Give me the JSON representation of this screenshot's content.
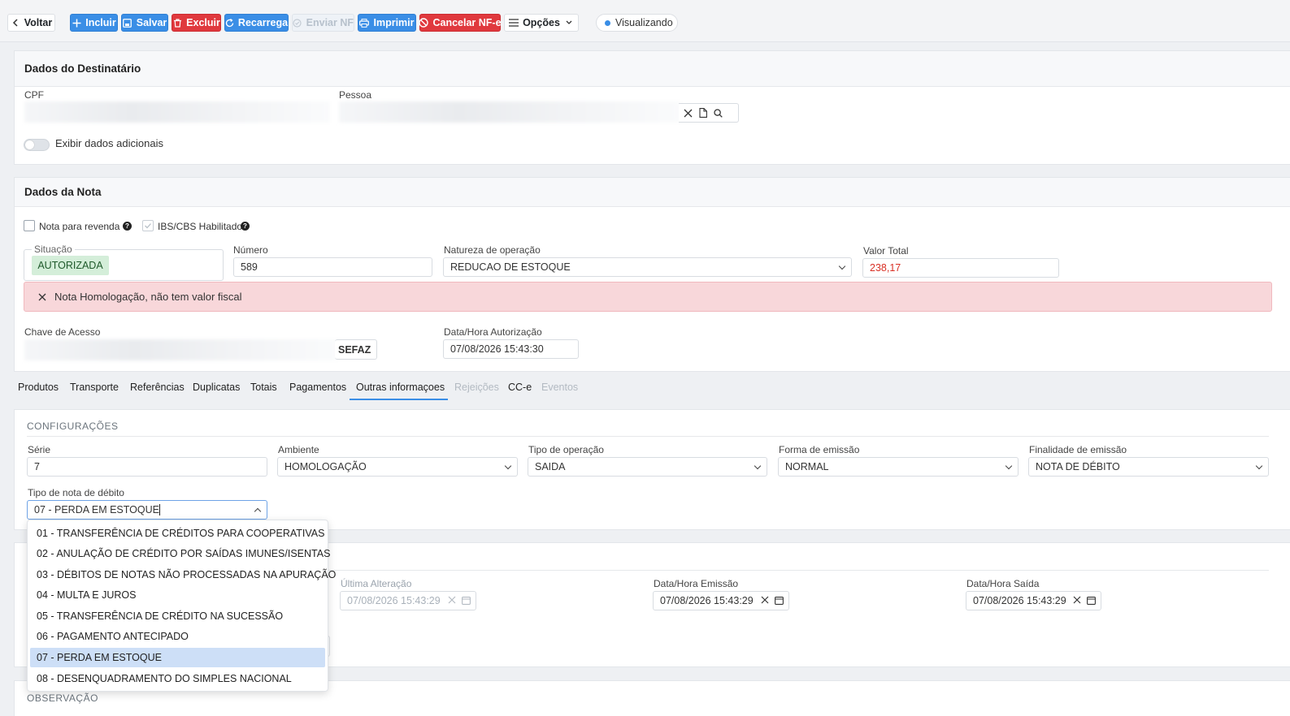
{
  "toolbar": {
    "back": "Voltar",
    "add": "Incluir",
    "save": "Salvar",
    "delete": "Excluir",
    "reload": "Recarrega",
    "send_nf": "Enviar NF",
    "print": "Imprimir",
    "cancel_nfe": "Cancelar NF-e",
    "options": "Opções",
    "status": "Visualizando"
  },
  "destinatario": {
    "title": "Dados do Destinatário",
    "cpf_label": "CPF",
    "pessoa_label": "Pessoa",
    "toggle_label": "Exibir dados adicionais"
  },
  "nota": {
    "title": "Dados da Nota",
    "revenda_label": "Nota para revenda",
    "ibs_label": "IBS/CBS Habilitado",
    "situacao_label": "Situação",
    "situacao_value": "AUTORIZADA",
    "numero_label": "Número",
    "numero_value": "589",
    "natureza_label": "Natureza de operação",
    "natureza_value": "REDUCAO DE ESTOQUE",
    "valor_label": "Valor Total",
    "valor_value": "238,17",
    "alert": "Nota Homologação, não tem valor fiscal",
    "chave_label": "Chave de Acesso",
    "sefaz_label": "SEFAZ",
    "autorizacao_label": "Data/Hora Autorização",
    "autorizacao_value": "07/08/2026 15:43:30"
  },
  "tabs": [
    "Produtos",
    "Transporte",
    "Referências",
    "Duplicatas",
    "Totais",
    "Pagamentos",
    "Outras informaçoes",
    "Rejeições",
    "CC-e",
    "Eventos"
  ],
  "config": {
    "title": "CONFIGURAÇÕES",
    "serie_label": "Série",
    "serie_value": "7",
    "ambiente_label": "Ambiente",
    "ambiente_value": "HOMOLOGAÇÃO",
    "tipo_op_label": "Tipo de operação",
    "tipo_op_value": "SAIDA",
    "forma_label": "Forma de emissão",
    "forma_value": "NORMAL",
    "finalidade_label": "Finalidade de emissão",
    "finalidade_value": "NOTA DE DÉBITO",
    "tipo_debito_label": "Tipo de nota de débito",
    "tipo_debito_value": "07 - PERDA EM ESTOQUE"
  },
  "datas": {
    "ultima_label": "Última Alteração",
    "ultima_value": "07/08/2026 15:43:29",
    "emissao_label": "Data/Hora Emissão",
    "emissao_value": "07/08/2026 15:43:29",
    "saida_label": "Data/Hora Saída",
    "saida_value": "07/08/2026 15:43:29"
  },
  "observacao": {
    "title": "OBSERVAÇÃO"
  },
  "dropdown_options": [
    "01 - TRANSFERÊNCIA DE CRÉDITOS PARA COOPERATIVAS",
    "02 - ANULAÇÃO DE CRÉDITO POR SAÍDAS IMUNES/ISENTAS",
    "03 - DÉBITOS DE NOTAS NÃO PROCESSADAS NA APURAÇÃO",
    "04 - MULTA E JUROS",
    "05 - TRANSFERÊNCIA DE CRÉDITO NA SUCESSÃO",
    "06 - PAGAMENTO ANTECIPADO",
    "07 - PERDA EM ESTOQUE",
    "08 - DESENQUADRAMENTO DO SIMPLES NACIONAL"
  ],
  "colors": {
    "primary": "#3a8ee6",
    "danger": "#e0393e",
    "success_bg": "#d4eed9",
    "alert_bg": "#f8d7da"
  }
}
